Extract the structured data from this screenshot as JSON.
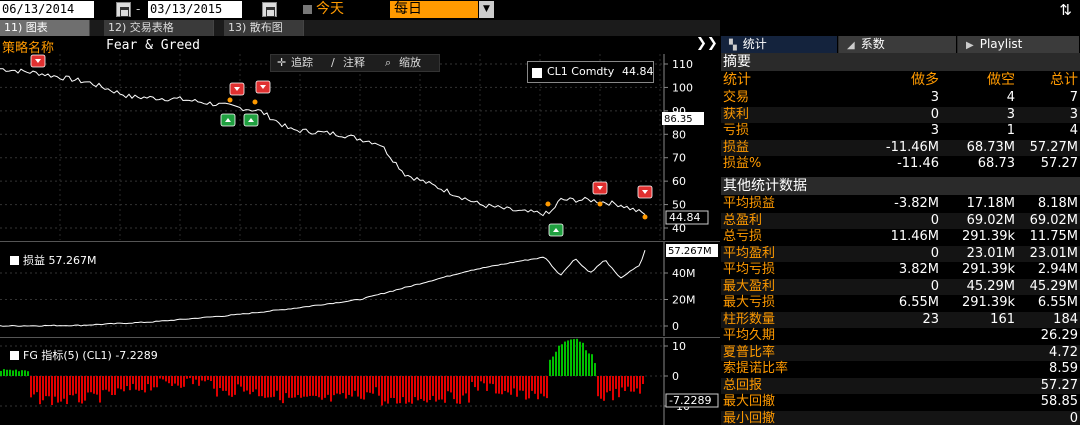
{
  "header": {
    "start_date": "06/13/2014",
    "end_date": "03/13/2015",
    "date_separator": "-",
    "mode": "今天",
    "period": "每日"
  },
  "tabs": [
    {
      "label": "11) 图表",
      "active": true
    },
    {
      "label": "12) 交易表格",
      "active": false
    },
    {
      "label": "13) 散布图",
      "active": false
    }
  ],
  "strategy": {
    "label": "策略名称",
    "value": "Fear & Greed"
  },
  "toolbar": {
    "trace": "追踪",
    "annotate": "注释",
    "zoom": "缩放"
  },
  "price_chart": {
    "legend_label": "CL1 Comdty",
    "legend_value": "44.84",
    "y_ticks": [
      "110",
      "100",
      "90",
      "80",
      "70",
      "60",
      "50",
      "40"
    ],
    "marker_value": "86.35",
    "last_value": "44.84"
  },
  "pnl_chart": {
    "label": "损益",
    "label_value": "57.267M",
    "last_value": "57.267M",
    "y_ticks": [
      "40M",
      "20M",
      "0"
    ]
  },
  "fg_chart": {
    "label": "FG 指标(5) (CL1)",
    "label_value": "-7.2289",
    "last_value": "-7.2289",
    "y_ticks": [
      "10",
      "0",
      "-10"
    ]
  },
  "right_tabs": [
    {
      "label": "统计",
      "icon": "stats-icon",
      "active": true
    },
    {
      "label": "系数",
      "icon": "chart-icon",
      "active": false
    },
    {
      "label": "Playlist",
      "icon": "play-icon",
      "active": false
    }
  ],
  "summary": {
    "title": "摘要",
    "columns": {
      "stat": "统计",
      "long": "做多",
      "short": "做空",
      "total": "总计"
    },
    "rows": [
      {
        "label": "交易",
        "long": "3",
        "short": "4",
        "total": "7"
      },
      {
        "label": "获利",
        "long": "0",
        "short": "3",
        "total": "3"
      },
      {
        "label": "亏损",
        "long": "3",
        "short": "1",
        "total": "4"
      },
      {
        "label": "损益",
        "long": "-11.46M",
        "short": "68.73M",
        "total": "57.27M"
      },
      {
        "label": "损益%",
        "long": "-11.46",
        "short": "68.73",
        "total": "57.27"
      }
    ]
  },
  "other_stats": {
    "title": "其他统计数据",
    "rows": [
      {
        "label": "平均损益",
        "long": "-3.82M",
        "short": "17.18M",
        "total": "8.18M"
      },
      {
        "label": "总盈利",
        "long": "0",
        "short": "69.02M",
        "total": "69.02M"
      },
      {
        "label": "总亏损",
        "long": "11.46M",
        "short": "291.39k",
        "total": "11.75M"
      },
      {
        "label": "平均盈利",
        "long": "0",
        "short": "23.01M",
        "total": "23.01M"
      },
      {
        "label": "平均亏损",
        "long": "3.82M",
        "short": "291.39k",
        "total": "2.94M"
      },
      {
        "label": "最大盈利",
        "long": "0",
        "short": "45.29M",
        "total": "45.29M"
      },
      {
        "label": "最大亏损",
        "long": "6.55M",
        "short": "291.39k",
        "total": "6.55M"
      },
      {
        "label": "柱形数量",
        "long": "23",
        "short": "161",
        "total": "184"
      },
      {
        "label": "平均久期",
        "long": "",
        "short": "",
        "total": "26.29"
      },
      {
        "label": "夏普比率",
        "long": "",
        "short": "",
        "total": "4.72"
      },
      {
        "label": "索提诺比率",
        "long": "",
        "short": "",
        "total": "8.59"
      },
      {
        "label": "总回报",
        "long": "",
        "short": "",
        "total": "57.27"
      },
      {
        "label": "最大回撤",
        "long": "",
        "short": "",
        "total": "58.85"
      },
      {
        "label": "最小回撤",
        "long": "",
        "short": "",
        "total": "0"
      }
    ]
  },
  "colors": {
    "accent": "#ff9a00",
    "up": "#00c000",
    "down": "#e00000"
  }
}
